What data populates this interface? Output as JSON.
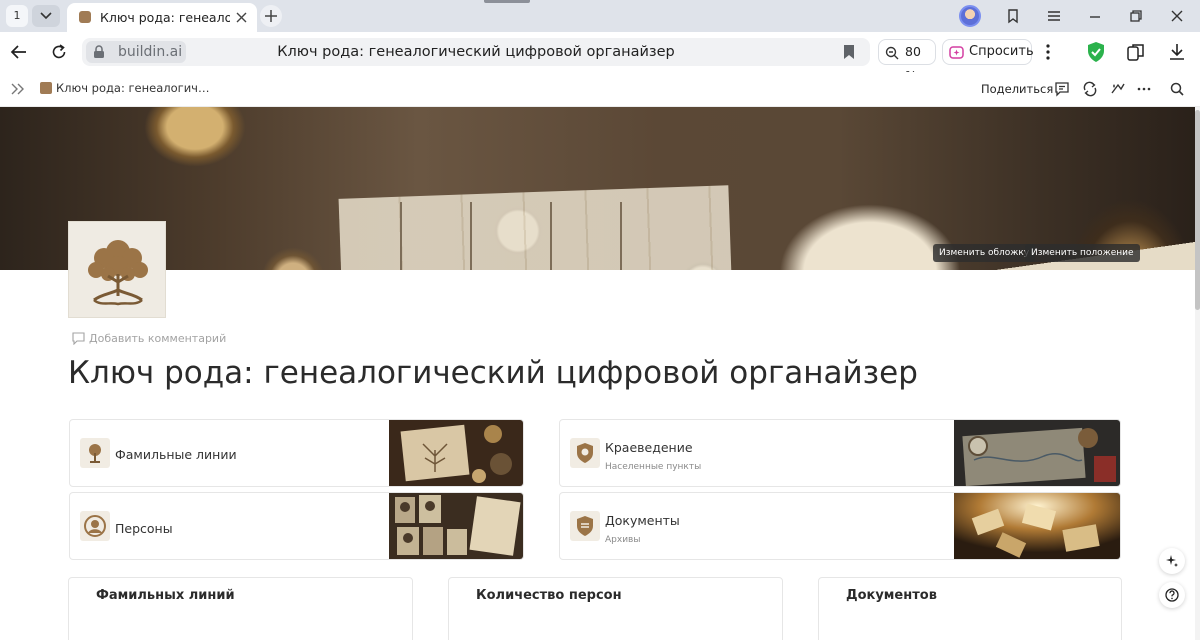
{
  "browser": {
    "tab_count": "1",
    "active_tab_title": "Ключ рода: генеалогический цифровой органайзер",
    "domain": "buildin.ai",
    "omnibox_title": "Ключ рода: генеалогический цифровой органайзер",
    "zoom": "80 %",
    "ask_label": "Спросить"
  },
  "appbar": {
    "breadcrumb": "Ключ рода: генеалогич…",
    "share_label": "Поделиться"
  },
  "cover": {
    "change_cover": "Изменить обложку",
    "change_position": "Изменить положение"
  },
  "page": {
    "add_comment": "Добавить комментарий",
    "title": "Ключ рода: генеалогический цифровой органайзер"
  },
  "cards": [
    {
      "title": "Фамильные линии",
      "subtitle": ""
    },
    {
      "title": "Краеведение",
      "subtitle": "Населенные пункты"
    },
    {
      "title": "Персоны",
      "subtitle": ""
    },
    {
      "title": "Документы",
      "subtitle": "Архивы"
    }
  ],
  "stats": [
    {
      "title": "Фамильных линий"
    },
    {
      "title": "Количество персон"
    },
    {
      "title": "Документов"
    }
  ],
  "colors": {
    "brand_brown": "#a07b55",
    "protect_green": "#2bb24c",
    "ask_magenta": "#d43fa2"
  }
}
